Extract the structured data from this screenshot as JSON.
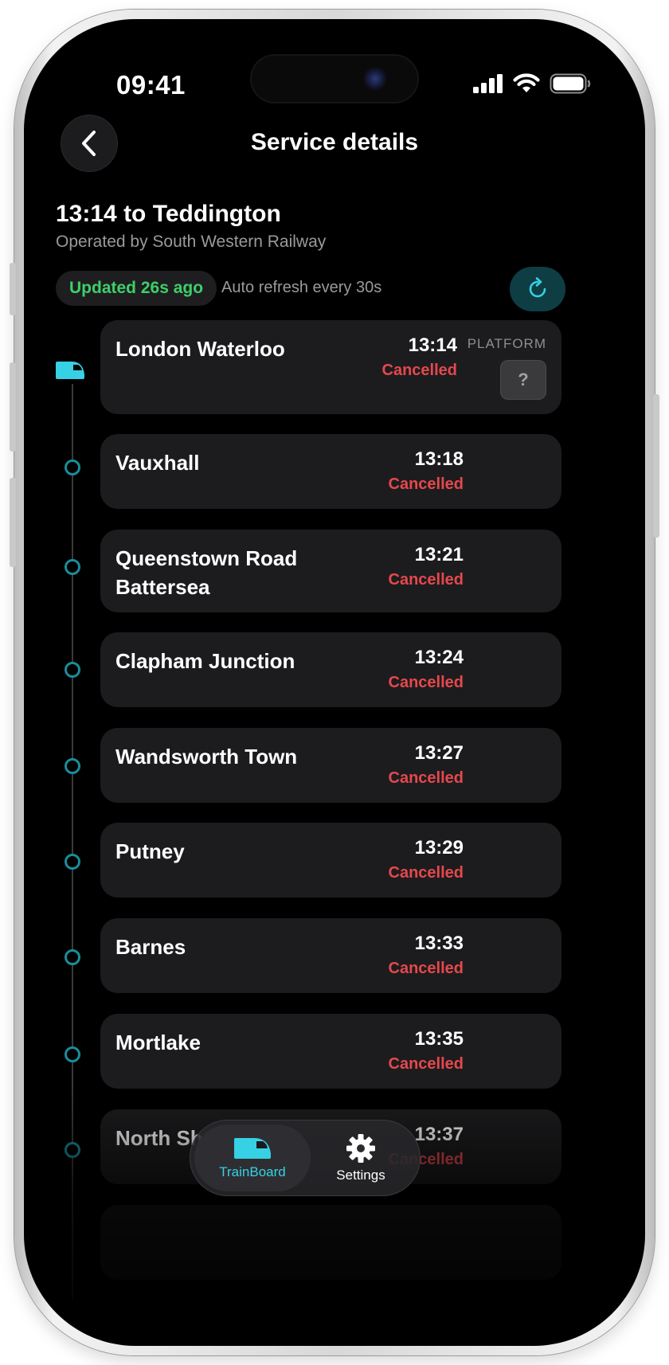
{
  "status_bar": {
    "time": "09:41"
  },
  "header": {
    "title": "Service details"
  },
  "service": {
    "title": "13:14 to Teddington",
    "operator": "Operated by South Western Railway",
    "updated": "Updated 26s ago",
    "auto_refresh": "Auto refresh every 30s"
  },
  "platform": {
    "label": "PLATFORM",
    "value": "?"
  },
  "stops": [
    {
      "name": "London Waterloo",
      "time": "13:14",
      "status": "Cancelled"
    },
    {
      "name": "Vauxhall",
      "time": "13:18",
      "status": "Cancelled"
    },
    {
      "name": "Queenstown Road Battersea",
      "time": "13:21",
      "status": "Cancelled"
    },
    {
      "name": "Clapham Junction",
      "time": "13:24",
      "status": "Cancelled"
    },
    {
      "name": "Wandsworth Town",
      "time": "13:27",
      "status": "Cancelled"
    },
    {
      "name": "Putney",
      "time": "13:29",
      "status": "Cancelled"
    },
    {
      "name": "Barnes",
      "time": "13:33",
      "status": "Cancelled"
    },
    {
      "name": "Mortlake",
      "time": "13:35",
      "status": "Cancelled"
    },
    {
      "name": "North Sh",
      "time": "13:37",
      "status": "Cancelled"
    }
  ],
  "tabs": [
    {
      "label": "TrainBoard",
      "icon": "train-icon",
      "active": true
    },
    {
      "label": "Settings",
      "icon": "gear-icon",
      "active": false
    }
  ],
  "colors": {
    "accent": "#36D1E4",
    "cancelled": "#E5484D",
    "updated": "#3ECF6A",
    "card": "#1C1C1E"
  }
}
